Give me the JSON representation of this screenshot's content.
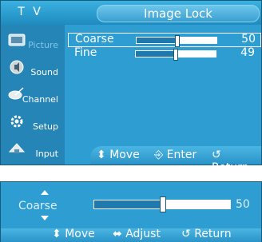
{
  "menu": {
    "section": "T V",
    "title": "Image Lock"
  },
  "sidebar": {
    "items": [
      {
        "label": "Picture",
        "icon": "picture-icon",
        "dim": true
      },
      {
        "label": "Sound",
        "icon": "sound-icon",
        "dim": false
      },
      {
        "label": "Channel",
        "icon": "channel-icon",
        "dim": false
      },
      {
        "label": "Setup",
        "icon": "setup-icon",
        "dim": false
      },
      {
        "label": "Input",
        "icon": "input-icon",
        "dim": false
      }
    ]
  },
  "settings": {
    "coarse": {
      "label": "Coarse",
      "value": "50",
      "level": 0.5
    },
    "fine": {
      "label": "Fine",
      "value": "49",
      "level": 0.49
    }
  },
  "hints": {
    "move": "Move",
    "enter": "Enter",
    "return": "Return"
  },
  "adjust_bar": {
    "label": "Coarse",
    "value": "50",
    "level": 0.5,
    "hints": {
      "move": "Move",
      "adjust": "Adjust",
      "return": "Return"
    }
  },
  "colors": {
    "accent": "#2e9dd1",
    "sidebar": "#2585b7",
    "slider_fill": "#1f79ad"
  }
}
